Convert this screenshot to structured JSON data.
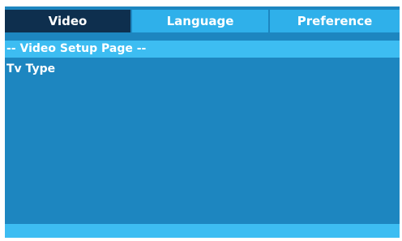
{
  "tabs": {
    "video": "Video",
    "language": "Language",
    "preference": "Preference"
  },
  "page_title": "-- Video Setup Page --",
  "menu": {
    "items": [
      "Tv Type"
    ]
  }
}
